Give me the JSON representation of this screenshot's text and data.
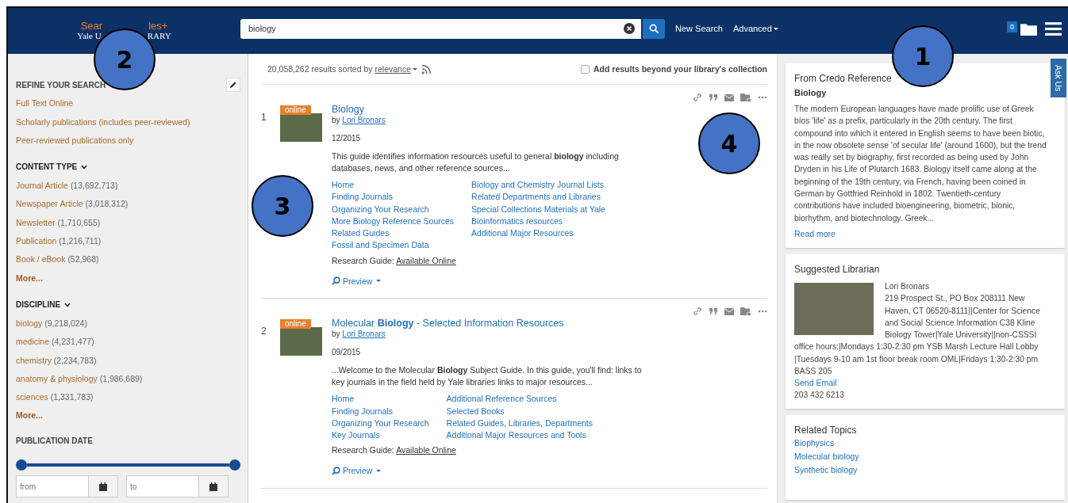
{
  "header": {
    "logo_top_left": "Sear",
    "logo_top_right": "les+",
    "logo_bottom_left": "Yale U",
    "logo_bottom_right": "RARY",
    "search": {
      "value": "biology"
    },
    "links": [
      {
        "label": "New Search",
        "kind": "plain"
      },
      {
        "label": "Advanced",
        "kind": "dropdown"
      }
    ],
    "folder_count": "0"
  },
  "sidebar": {
    "refine": {
      "title": "REFINE YOUR SEARCH",
      "items": [
        "Full Text Online",
        "Scholarly publications (includes peer-reviewed)",
        "Peer-reviewed publications only"
      ]
    },
    "facets": [
      {
        "title": "CONTENT TYPE",
        "expanded": true,
        "items": [
          {
            "label": "Journal Article",
            "count": "(13,692,713)"
          },
          {
            "label": "Newspaper Article",
            "count": "(3,018,312)"
          },
          {
            "label": "Newsletter",
            "count": "(1,710,655)"
          },
          {
            "label": "Publication",
            "count": "(1,216,711)"
          },
          {
            "label": "Book / eBook",
            "count": "(52,968)"
          }
        ],
        "more": "More..."
      },
      {
        "title": "DISCIPLINE",
        "expanded": true,
        "items": [
          {
            "label": "biology",
            "count": "(9,218,024)"
          },
          {
            "label": "medicine",
            "count": "(4,231,477)"
          },
          {
            "label": "chemistry",
            "count": "(2,234,783)"
          },
          {
            "label": "anatomy & physiology",
            "count": "(1,986,689)"
          },
          {
            "label": "sciences",
            "count": "(1,331,783)"
          }
        ],
        "more": "More..."
      }
    ],
    "publication_date": {
      "title": "PUBLICATION DATE",
      "thumbs": [
        {
          "level": 0
        },
        {
          "level": 1
        }
      ],
      "from_placeholder": "from",
      "to_placeholder": "to"
    }
  },
  "results_header": {
    "count_text": "20,058,262 results sorted by",
    "sort": "relevance",
    "beyond": {
      "label": "Add results beyond your library's collection",
      "checked": false
    }
  },
  "results": [
    {
      "number": "1",
      "badge": "online",
      "title": "Biology",
      "by": "by",
      "author": "Lori Bronars",
      "date": "12/2015",
      "snippet": "This guide identifies information resources useful to general **biology** including databases, news, and other reference sources...",
      "link_columns": [
        [
          "Home",
          "Finding Journals",
          "Organizing Your Research",
          "More Biology Reference Sources",
          "Related Guides",
          "Fossil and Specimen Data"
        ],
        [
          "Biology and Chemistry Journal Lists",
          "Related Departments and Libraries",
          "Special Collections Materials at Yale",
          "Bioinformatics resources",
          "Additional Major Resources"
        ]
      ],
      "guide_label": "Research Guide:",
      "guide_link": "Available Online",
      "preview": "Preview"
    },
    {
      "number": "2",
      "badge": "online",
      "title": "Molecular **Biology** - Selected Information Resources",
      "by": "by",
      "author": "Lori Bronars",
      "date": "09/2015",
      "snippet": "...Welcome to the Molecular **Biology** Subject Guide. In this guide, you'll find: links to key journals in the field held by Yale libraries links to major resources...",
      "link_columns": [
        [
          "Home",
          "Finding Journals",
          "Organizing Your Research",
          "Key Journals"
        ],
        [
          "Additional Reference Sources",
          "Selected Books",
          "Related Guides, Libraries, Departments",
          "Additional Major Resources and Tools"
        ]
      ],
      "guide_label": "Research Guide:",
      "guide_link": "Available Online",
      "preview": "Preview"
    }
  ],
  "credo": {
    "title": "From Credo Reference",
    "subtitle": "Biology",
    "text": "The modern European languages have made prolific use of Greek bíos 'life' as a prefix, particularly in the 20th century. The first compound into which it entered in English seems to have been biotic, in the now obsolete sense 'of secular life' (around 1600), but the trend was really set by biography, first recorded as being used by John Dryden in his Life of Plutarch 1683. Biology itself came along at the beginning of the 19th century, via French, having been coined in German by Gottfried Reinhold in 1802. Twentieth-century contributions have included bioengineering, biometric, bionic, biorhythm, and biotechnology. Greek...",
    "read_more": "Read more"
  },
  "librarian": {
    "title": "Suggested Librarian",
    "name": "Lori Bronars",
    "address_beside": "219 Prospect St., PO Box 208111 New Haven, CT 06520-8111||Center for Science and Social Science Information C38 Kline Biology Tower|Yale University||non-CSSSI",
    "address_below": "office hours:|Mondays 1:30-2:30 pm YSB Marsh Lecture Hall Lobby |Tuesdays 9-10 am 1st floor break room OML|Fridays 1:30-2:30 pm BASS 205",
    "email": "Send Email",
    "phone": "203 432 6213"
  },
  "related_topics": {
    "title": "Related Topics",
    "items": [
      "Biophysics",
      "Molecular biology",
      "Synthetic biology"
    ]
  },
  "ask_us": "Ask Us",
  "callouts": [
    {
      "label": "1"
    },
    {
      "label": "2"
    },
    {
      "label": "3"
    },
    {
      "label": "4"
    }
  ]
}
